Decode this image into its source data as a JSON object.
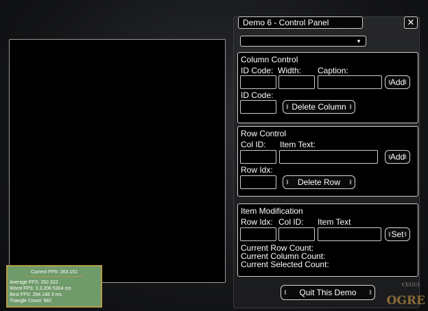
{
  "fps": {
    "current": "Current FPS: 263.151",
    "average": "Average FPS: 262.322",
    "worst": "Worst FPS: 3.3.206 5304 ms",
    "best": "Best FPS: 284.148 3 ms",
    "triangles": "Triangle Count: 982"
  },
  "window": {
    "title": "Demo 6 - Control Panel",
    "close_glyph": "✕"
  },
  "combo": {
    "arrow": "▾"
  },
  "column_control": {
    "title": "Column Control",
    "id_code_label": "ID Code:",
    "width_label": "Width:",
    "caption_label": "Caption:",
    "add_label": "Add",
    "id_code2_label": "ID Code:",
    "delete_label": "Delete Column"
  },
  "row_control": {
    "title": "Row Control",
    "col_id_label": "Col ID:",
    "item_text_label": "Item Text:",
    "add_label": "Add",
    "row_idx_label": "Row Idx:",
    "delete_label": "Delete Row"
  },
  "item_mod": {
    "title": "Item Modification",
    "row_idx_label": "Row Idx:",
    "col_id_label": "Col ID:",
    "item_text_label": "Item Text",
    "set_label": "Set",
    "row_count": "Current Row Count:",
    "col_count": "Current Column Count:",
    "sel_count": "Current Selected Count:"
  },
  "quit_label": "Quit This Demo",
  "logo": {
    "main": "OGRE",
    "sub": "CEGUI"
  }
}
